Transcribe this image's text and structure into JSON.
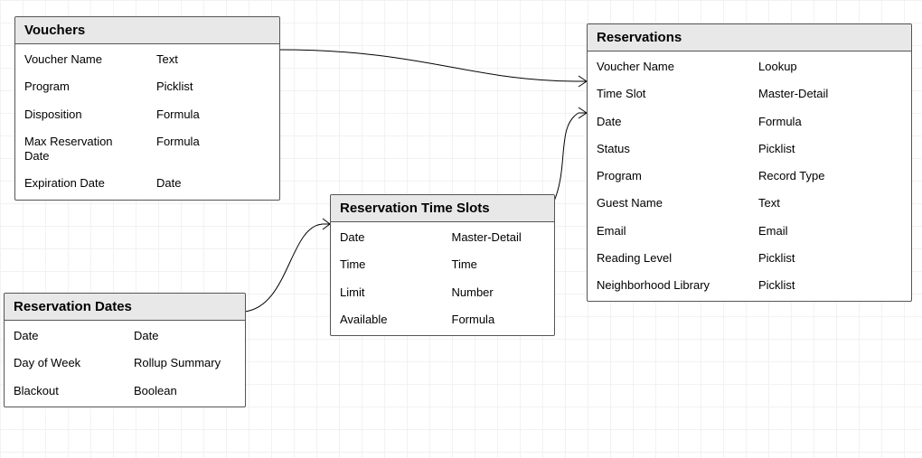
{
  "entities": {
    "vouchers": {
      "title": "Vouchers",
      "fields": [
        {
          "name": "Voucher Name",
          "type": "Text"
        },
        {
          "name": "Program",
          "type": "Picklist"
        },
        {
          "name": "Disposition",
          "type": "Formula"
        },
        {
          "name": "Max Reservation Date",
          "type": "Formula"
        },
        {
          "name": "Expiration Date",
          "type": "Date"
        }
      ]
    },
    "reservation_dates": {
      "title": "Reservation Dates",
      "fields": [
        {
          "name": "Date",
          "type": "Date"
        },
        {
          "name": "Day of Week",
          "type": "Rollup Summary"
        },
        {
          "name": "Blackout",
          "type": "Boolean"
        }
      ]
    },
    "reservation_time_slots": {
      "title": "Reservation Time Slots",
      "fields": [
        {
          "name": "Date",
          "type": "Master-Detail"
        },
        {
          "name": "Time",
          "type": "Time"
        },
        {
          "name": "Limit",
          "type": "Number"
        },
        {
          "name": "Available",
          "type": "Formula"
        }
      ]
    },
    "reservations": {
      "title": "Reservations",
      "fields": [
        {
          "name": "Voucher Name",
          "type": "Lookup"
        },
        {
          "name": "Time Slot",
          "type": "Master-Detail"
        },
        {
          "name": "Date",
          "type": "Formula"
        },
        {
          "name": "Status",
          "type": "Picklist"
        },
        {
          "name": "Program",
          "type": "Record Type"
        },
        {
          "name": "Guest Name",
          "type": "Text"
        },
        {
          "name": "Email",
          "type": "Email"
        },
        {
          "name": "Reading Level",
          "type": "Picklist"
        },
        {
          "name": "Neighborhood Library",
          "type": "Picklist"
        }
      ]
    }
  }
}
